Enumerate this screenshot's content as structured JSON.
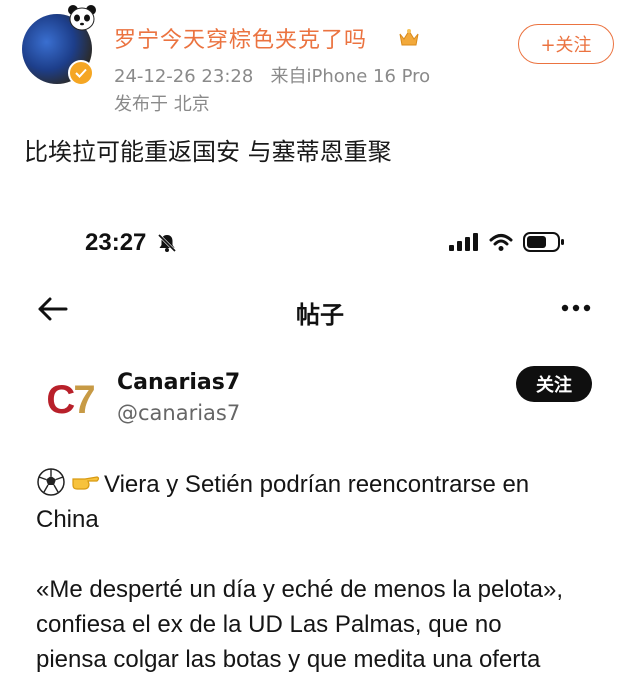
{
  "weibo": {
    "username": "罗宁今天穿棕色夹克了吗",
    "timestamp": "24-12-26 23:28",
    "source": "来自iPhone 16 Pro",
    "location": "发布于 北京",
    "follow_label": "+关注",
    "post_text": "比埃拉可能重返国安 与塞蒂恩重聚",
    "accent": "#eb7340"
  },
  "screenshot": {
    "status": {
      "time": "23:27"
    },
    "nav": {
      "title": "帖子"
    },
    "account": {
      "logo_c": "C",
      "logo_7": "7",
      "name": "Canarias7",
      "handle": "@canarias7",
      "follow_label": "关注"
    },
    "tweet": {
      "line1": "Viera y Setién podrían reencontrarse en",
      "line2": "China",
      "line3": "«Me desperté un día y eché de menos la pelota»,",
      "line4": "confiesa el ex de la UD Las Palmas, que no",
      "line5": "piensa colgar las botas y que medita una oferta"
    }
  },
  "icons": [
    "soccer-ball-icon",
    "pointing-hand-icon",
    "bell-slash-icon",
    "signal-icon",
    "wifi-icon",
    "battery-icon",
    "back-arrow-icon",
    "more-icon",
    "crown-icon",
    "verified-icon",
    "panda-icon"
  ]
}
